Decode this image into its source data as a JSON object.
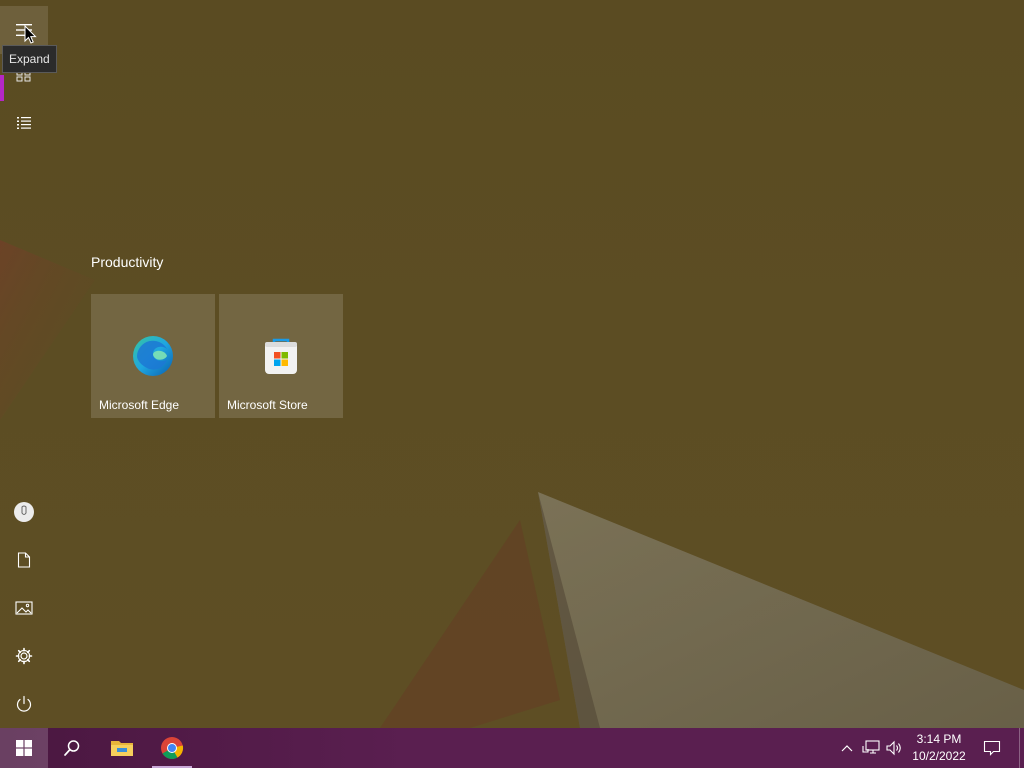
{
  "start_menu": {
    "rail": {
      "expand_tooltip": "Expand"
    },
    "group": {
      "title": "Productivity",
      "tiles": [
        {
          "label": "Microsoft Edge",
          "icon": "edge-icon"
        },
        {
          "label": "Microsoft Store",
          "icon": "store-icon"
        }
      ]
    }
  },
  "taskbar": {
    "buttons": [
      "start-icon",
      "search-icon",
      "file-explorer-icon",
      "chrome-icon"
    ],
    "tray": {
      "time": "3:14 PM",
      "date": "10/2/2022"
    }
  },
  "colors": {
    "rail_accent": "#b427c6",
    "taskbar": "#5a1f50",
    "backdrop": "#5b4c20"
  }
}
